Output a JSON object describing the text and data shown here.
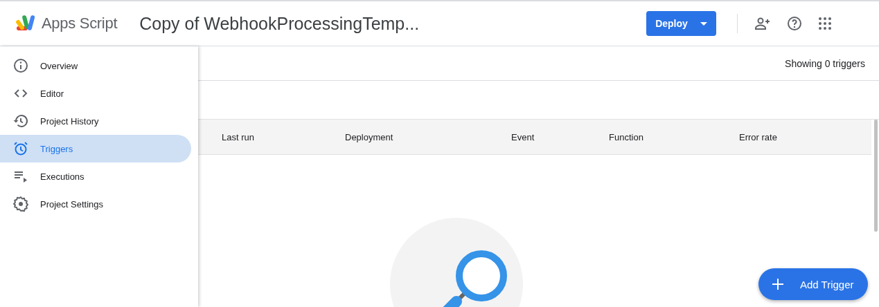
{
  "header": {
    "product": "Apps Script",
    "project_title": "Copy of WebhookProcessingTemp...",
    "deploy_button": "Deploy"
  },
  "sidebar": {
    "items": [
      {
        "label": "Overview",
        "selected": false
      },
      {
        "label": "Editor",
        "selected": false
      },
      {
        "label": "Project History",
        "selected": false
      },
      {
        "label": "Triggers",
        "selected": true
      },
      {
        "label": "Executions",
        "selected": false
      },
      {
        "label": "Project Settings",
        "selected": false
      }
    ]
  },
  "toolbar": {
    "count_text": "Showing 0 triggers"
  },
  "table": {
    "columns": [
      "Last run",
      "Deployment",
      "Event",
      "Function",
      "Error rate"
    ]
  },
  "fab": {
    "label": "Add Trigger"
  }
}
